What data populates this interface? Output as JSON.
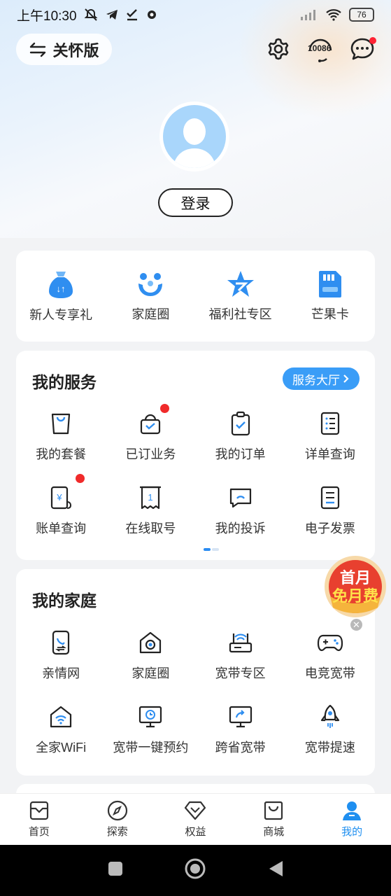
{
  "status_bar": {
    "time": "上午10:30",
    "battery": "76"
  },
  "header": {
    "care_mode_label": "关怀版",
    "hotline_label": "10086"
  },
  "profile": {
    "login_label": "登录"
  },
  "quick_links": [
    {
      "label": "新人专享礼",
      "icon": "gift-bag-icon"
    },
    {
      "label": "家庭圈",
      "icon": "family-icon"
    },
    {
      "label": "福利社专区",
      "icon": "star-icon"
    },
    {
      "label": "芒果卡",
      "icon": "sim-card-icon"
    }
  ],
  "services": {
    "title": "我的服务",
    "hall_button": "服务大厅",
    "items": [
      {
        "label": "我的套餐",
        "icon": "bag-icon"
      },
      {
        "label": "已订业务",
        "icon": "basket-check-icon"
      },
      {
        "label": "我的订单",
        "icon": "clipboard-check-icon"
      },
      {
        "label": "详单查询",
        "icon": "list-doc-icon"
      },
      {
        "label": "账单查询",
        "icon": "bill-yen-icon"
      },
      {
        "label": "在线取号",
        "icon": "ticket-icon"
      },
      {
        "label": "我的投诉",
        "icon": "complaint-icon"
      },
      {
        "label": "电子发票",
        "icon": "invoice-icon"
      }
    ]
  },
  "family": {
    "title": "我的家庭",
    "items": [
      {
        "label": "亲情网",
        "icon": "phone-link-icon"
      },
      {
        "label": "家庭圈",
        "icon": "home-camera-icon"
      },
      {
        "label": "宽带专区",
        "icon": "router-icon"
      },
      {
        "label": "电竞宽带",
        "icon": "gamepad-icon"
      },
      {
        "label": "全家WiFi",
        "icon": "home-wifi-icon"
      },
      {
        "label": "宽带一键预约",
        "icon": "monitor-clock-icon"
      },
      {
        "label": "跨省宽带",
        "icon": "monitor-share-icon"
      },
      {
        "label": "宽带提速",
        "icon": "rocket-icon"
      }
    ]
  },
  "promo": {
    "line1": "首月",
    "line2": "免月费"
  },
  "bottom_nav": [
    {
      "label": "首页"
    },
    {
      "label": "探索"
    },
    {
      "label": "权益"
    },
    {
      "label": "商城"
    },
    {
      "label": "我的"
    }
  ],
  "colors": {
    "accent": "#1f8ff0",
    "badge": "#f02a2a",
    "hall_button": "#3a9df7"
  }
}
